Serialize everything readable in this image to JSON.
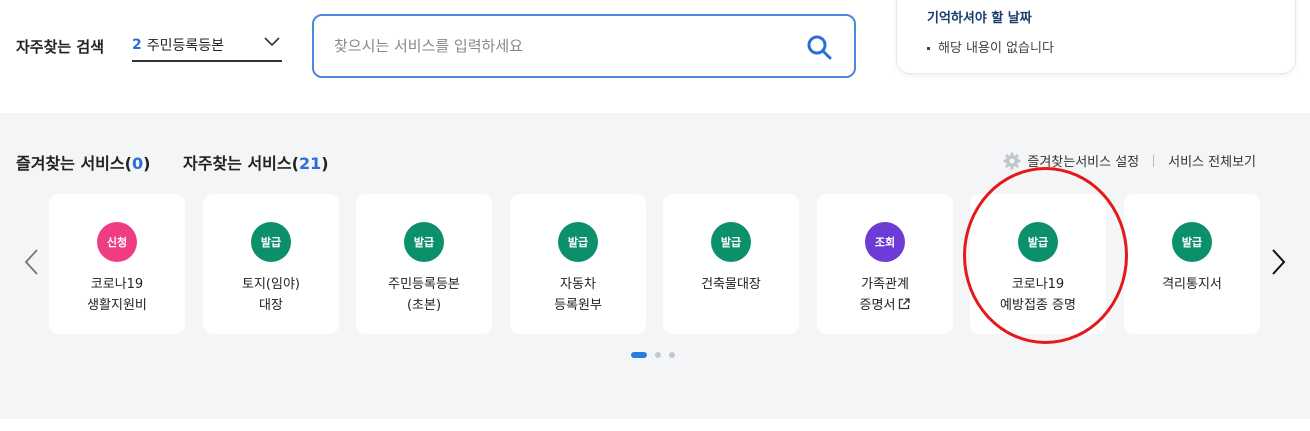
{
  "frequent_search": {
    "label": "자주찾는 검색",
    "selected_number": "2",
    "selected_value": "주민등록등본"
  },
  "search": {
    "placeholder": "찾으시는 서비스를 입력하세요",
    "value": ""
  },
  "remember": {
    "title": "기억하셔야 할 날짜",
    "empty_text": "해당 내용이 없습니다"
  },
  "tabs": {
    "favorite_label": "즐겨찾는 서비스",
    "favorite_count": "0",
    "frequent_label": "자주찾는 서비스",
    "frequent_count": "21"
  },
  "links": {
    "favorite_settings": "즐겨찾는서비스 설정",
    "all_services": "서비스 전체보기"
  },
  "colors": {
    "apply": "#ef3d83",
    "issue": "#0c8f6b",
    "inquiry": "#6d3cd6",
    "accent": "#2a7be0"
  },
  "cards": [
    {
      "badge": "신청",
      "badge_type": "apply",
      "line1": "코로나19",
      "line2": "생활지원비",
      "external": false
    },
    {
      "badge": "발급",
      "badge_type": "issue",
      "line1": "토지(임야)",
      "line2": "대장",
      "external": false
    },
    {
      "badge": "발급",
      "badge_type": "issue",
      "line1": "주민등록등본",
      "line2": "(초본)",
      "external": false
    },
    {
      "badge": "발급",
      "badge_type": "issue",
      "line1": "자동차",
      "line2": "등록원부",
      "external": false
    },
    {
      "badge": "발급",
      "badge_type": "issue",
      "line1": "건축물대장",
      "line2": "",
      "external": false
    },
    {
      "badge": "조회",
      "badge_type": "inquiry",
      "line1": "가족관계",
      "line2": "증명서",
      "external": true
    },
    {
      "badge": "발급",
      "badge_type": "issue",
      "line1": "코로나19",
      "line2": "예방접종 증명",
      "external": false
    },
    {
      "badge": "발급",
      "badge_type": "issue",
      "line1": "격리통지서",
      "line2": "",
      "external": false
    }
  ],
  "pagination": {
    "current": 1,
    "total": 3
  }
}
